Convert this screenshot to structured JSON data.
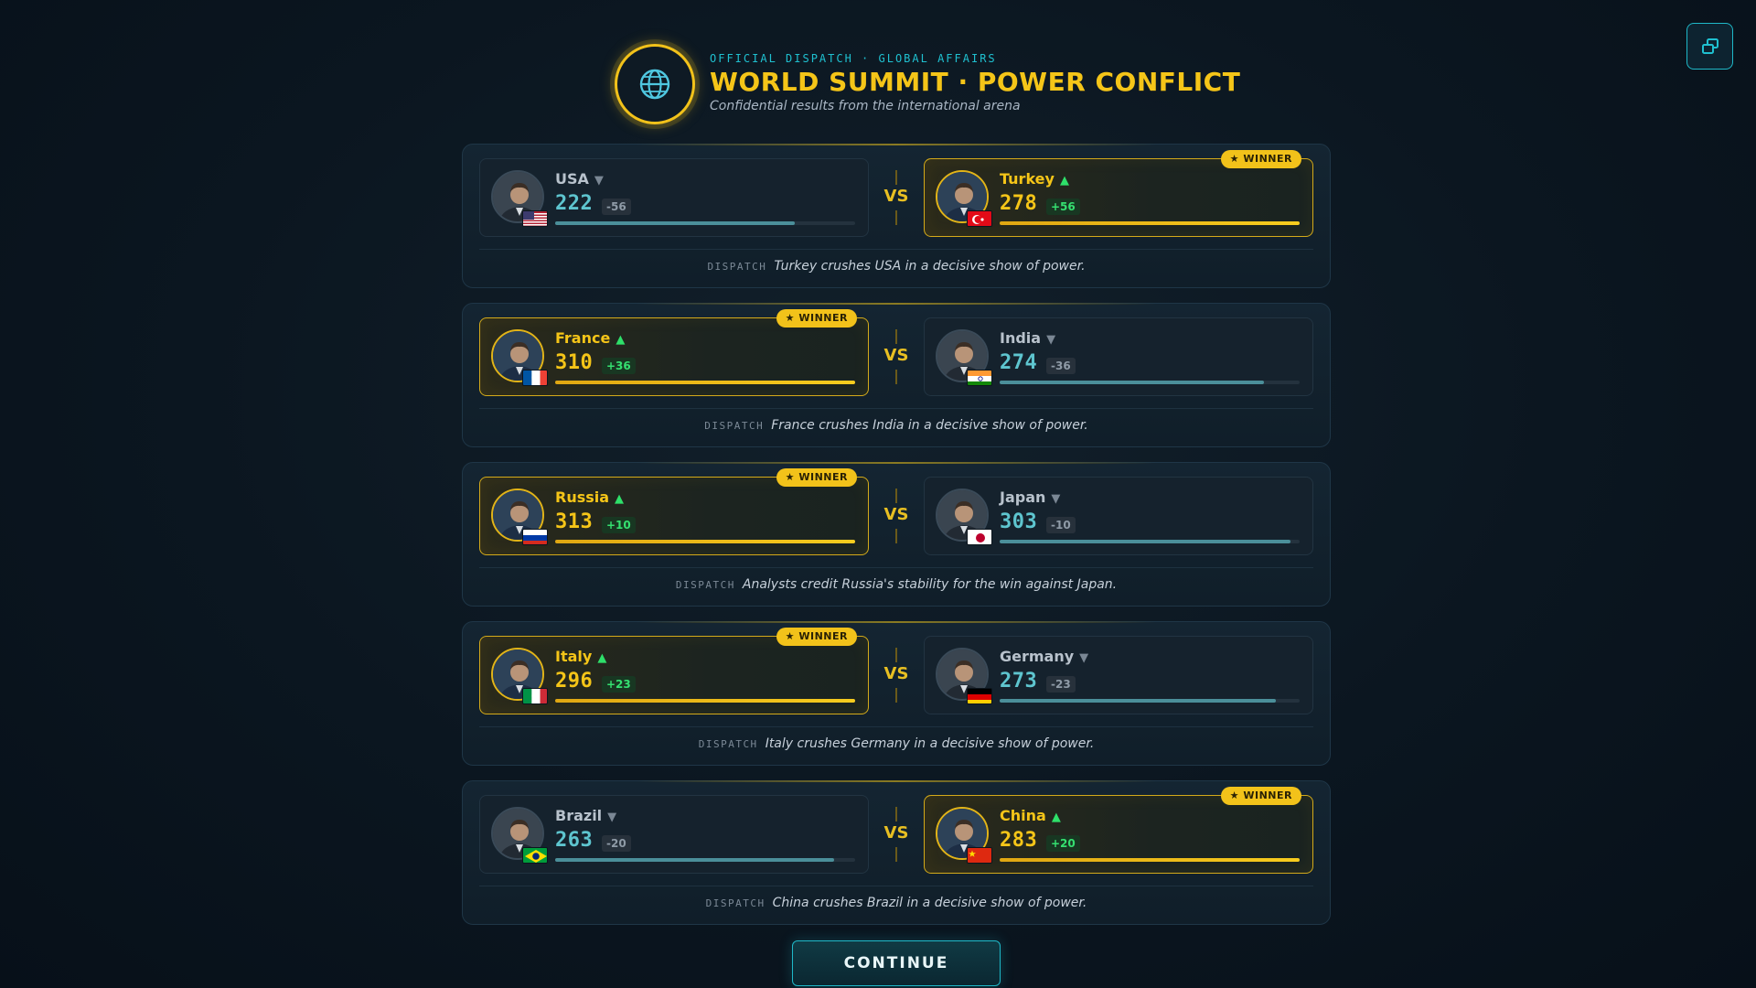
{
  "header": {
    "kicker": "OFFICIAL DISPATCH · GLOBAL AFFAIRS",
    "title": "WORLD SUMMIT · POWER CONFLICT",
    "subtitle": "Confidential results from the international arena"
  },
  "vs_label": "VS",
  "winner_label": "★ WINNER",
  "dispatch_tag": "DISPATCH",
  "continue_label": "CONTINUE",
  "colors": {
    "accent_gold": "#f5c518",
    "accent_cyan": "#1fb8c8",
    "gain_green": "#35e070"
  },
  "matches": [
    {
      "left": {
        "country": "USA",
        "arrow": "▼",
        "score": "222",
        "delta": "-56",
        "bar_fraction": 0.8,
        "winner": false,
        "flag": "usa"
      },
      "right": {
        "country": "Turkey",
        "arrow": "▲",
        "score": "278",
        "delta": "+56",
        "bar_fraction": 1.0,
        "winner": true,
        "flag": "turkey"
      },
      "dispatch": "Turkey crushes USA in a decisive show of power."
    },
    {
      "left": {
        "country": "France",
        "arrow": "▲",
        "score": "310",
        "delta": "+36",
        "bar_fraction": 1.0,
        "winner": true,
        "flag": "france"
      },
      "right": {
        "country": "India",
        "arrow": "▼",
        "score": "274",
        "delta": "-36",
        "bar_fraction": 0.88,
        "winner": false,
        "flag": "india"
      },
      "dispatch": "France crushes India in a decisive show of power."
    },
    {
      "left": {
        "country": "Russia",
        "arrow": "▲",
        "score": "313",
        "delta": "+10",
        "bar_fraction": 1.0,
        "winner": true,
        "flag": "russia"
      },
      "right": {
        "country": "Japan",
        "arrow": "▼",
        "score": "303",
        "delta": "-10",
        "bar_fraction": 0.97,
        "winner": false,
        "flag": "japan"
      },
      "dispatch": "Analysts credit Russia's stability for the win against Japan."
    },
    {
      "left": {
        "country": "Italy",
        "arrow": "▲",
        "score": "296",
        "delta": "+23",
        "bar_fraction": 1.0,
        "winner": true,
        "flag": "italy"
      },
      "right": {
        "country": "Germany",
        "arrow": "▼",
        "score": "273",
        "delta": "-23",
        "bar_fraction": 0.92,
        "winner": false,
        "flag": "germany"
      },
      "dispatch": "Italy crushes Germany in a decisive show of power."
    },
    {
      "left": {
        "country": "Brazil",
        "arrow": "▼",
        "score": "263",
        "delta": "-20",
        "bar_fraction": 0.93,
        "winner": false,
        "flag": "brazil"
      },
      "right": {
        "country": "China",
        "arrow": "▲",
        "score": "283",
        "delta": "+20",
        "bar_fraction": 1.0,
        "winner": true,
        "flag": "china"
      },
      "dispatch": "China crushes Brazil in a decisive show of power."
    }
  ]
}
